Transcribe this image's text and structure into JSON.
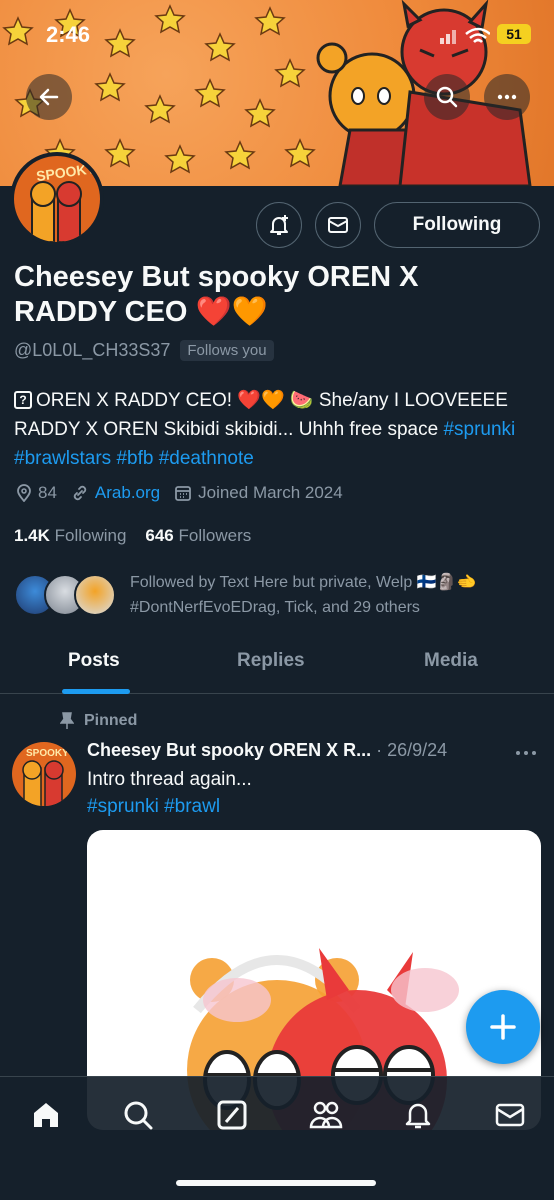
{
  "status_bar": {
    "time": "2:46",
    "battery": "51"
  },
  "profile": {
    "avatar_label": "SPOOKY",
    "display_name": "Cheesey But spooky OREN X RADDY CEO ❤️🧡",
    "handle": "@L0L0L_CH33S37",
    "follows_you": "Follows you",
    "following_button": "Following",
    "bio_prefix": "OREN X RADDY CEO! ❤️🧡 🍉 She/any I LOOVEEEE RADDY X OREN Skibidi skibidi... Uhhh free space ",
    "bio_tags": [
      "#sprunki",
      "#brawlstars",
      "#bfb",
      "#deathnote"
    ],
    "location": "84",
    "website": "Arab.org",
    "joined": "Joined March 2024",
    "following_count": "1.4K",
    "following_label": "Following",
    "followers_count": "646",
    "followers_label": "Followers",
    "followed_by": "Followed by Text Here but private, Welp 🇫🇮🗿🫲 #DontNerfEvoEDrag, Tick, and 29 others"
  },
  "tabs": [
    {
      "label": "Posts",
      "active": true
    },
    {
      "label": "Replies",
      "active": false
    },
    {
      "label": "Media",
      "active": false
    }
  ],
  "pinned_post": {
    "pinned_label": "Pinned",
    "author": "Cheesey But spooky OREN X R...",
    "date": "· 26/9/24",
    "avatar_label": "SPOOKY",
    "text": "Intro thread again...",
    "tags": "#sprunki #brawl"
  },
  "colors": {
    "background": "#15202b",
    "accent": "#1d9bf0",
    "muted": "#8b98a5",
    "border": "#536471",
    "banner": "#ef8a3b"
  },
  "icons": {
    "back": "arrow-left-icon",
    "search": "search-icon",
    "more": "more-horizontal-icon",
    "notify": "bell-plus-icon",
    "message": "envelope-icon",
    "location": "location-pin-icon",
    "link": "link-icon",
    "calendar": "calendar-icon",
    "pin": "pin-icon",
    "fab": "plus-icon",
    "nav": [
      "home-icon",
      "explore-icon",
      "grok-icon",
      "communities-icon",
      "notifications-icon",
      "messages-icon"
    ]
  }
}
